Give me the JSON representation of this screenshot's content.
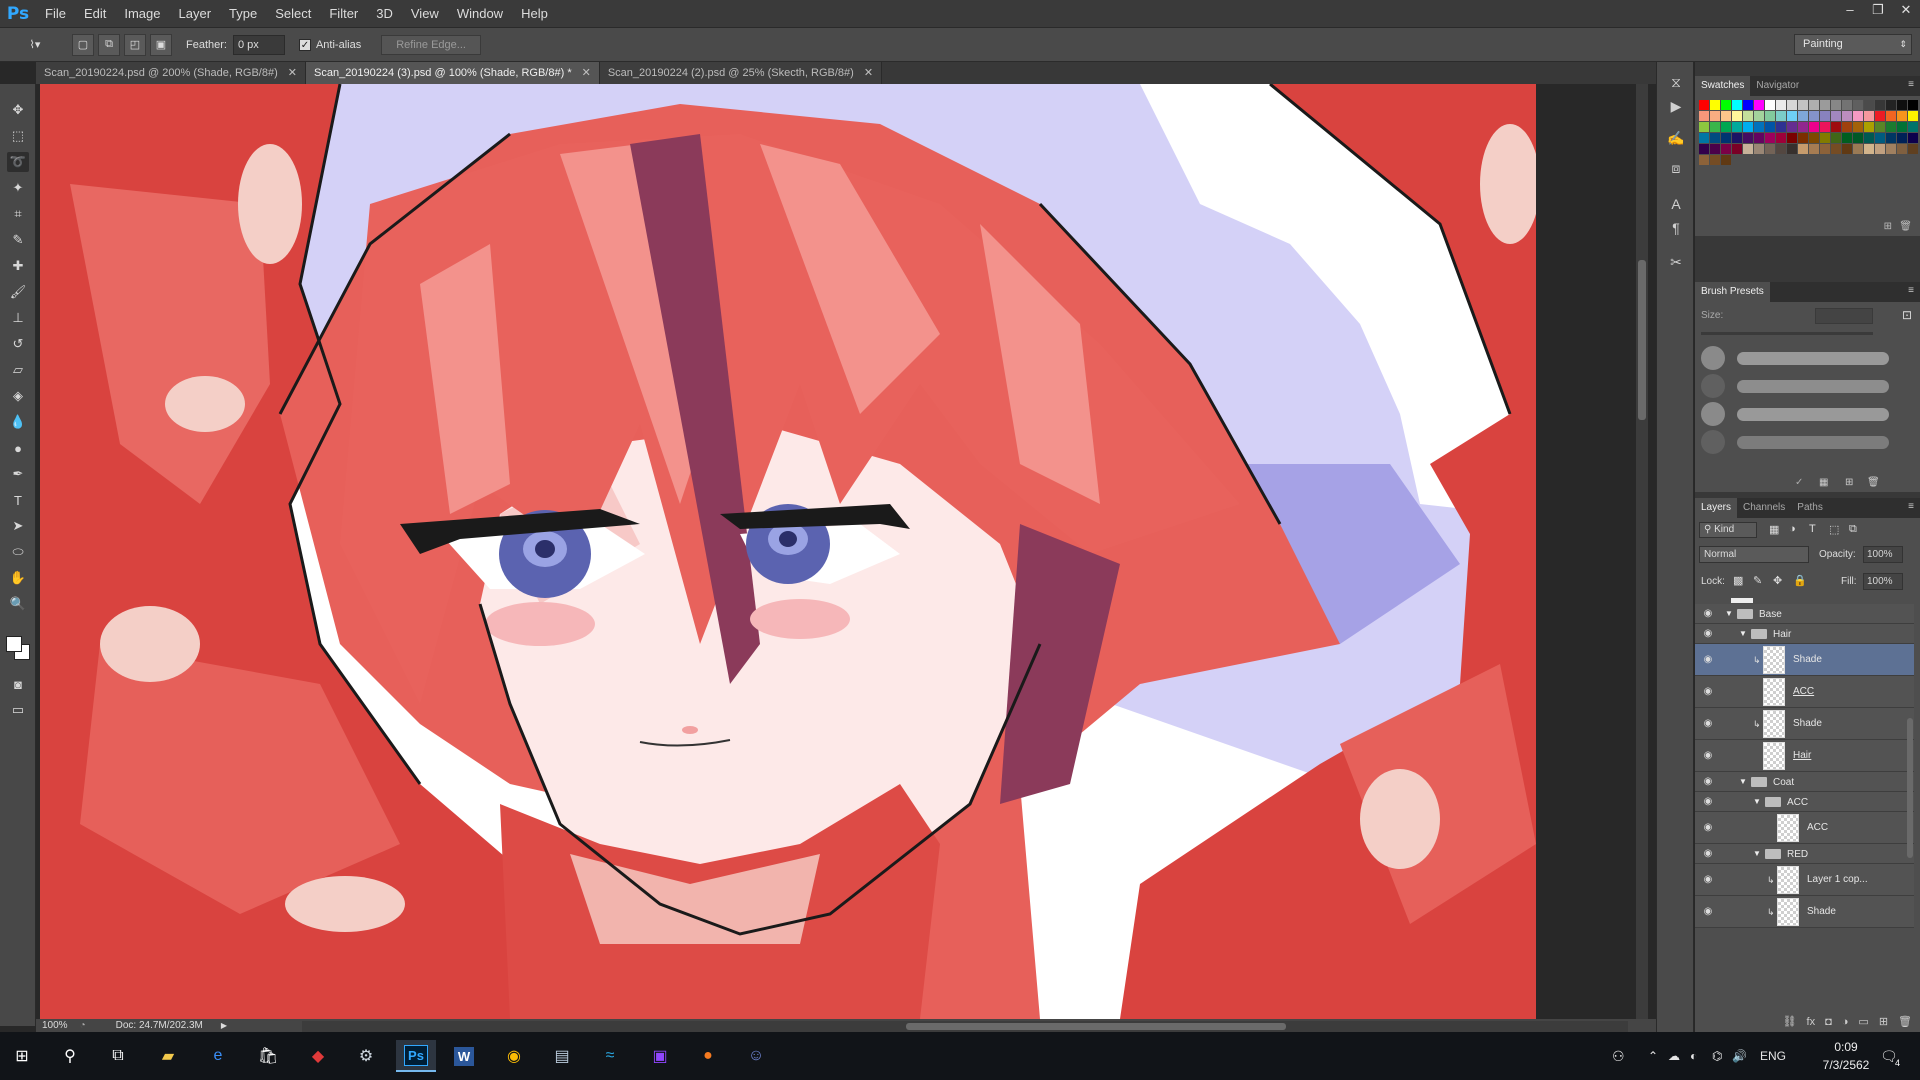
{
  "app": {
    "logo": "Ps"
  },
  "menu": [
    "File",
    "Edit",
    "Image",
    "Layer",
    "Type",
    "Select",
    "Filter",
    "3D",
    "View",
    "Window",
    "Help"
  ],
  "window_controls": [
    "–",
    "❐",
    "✕"
  ],
  "options": {
    "feather_label": "Feather:",
    "feather_value": "0 px",
    "antialias_label": "Anti-alias",
    "antialias_checked": true,
    "refine_edge": "Refine Edge...",
    "workspace": "Painting"
  },
  "doc_tabs": [
    {
      "label": "Scan_20190224.psd @ 200% (Shade, RGB/8#)",
      "active": false
    },
    {
      "label": "Scan_20190224 (3).psd @ 100% (Shade, RGB/8#) *",
      "active": true
    },
    {
      "label": "Scan_20190224 (2).psd @ 25% (Skecth, RGB/8#)",
      "active": false
    }
  ],
  "status": {
    "zoom": "100%",
    "doc": "Doc: 24.7M/202.3M"
  },
  "colors": {
    "panel_bg": "#383838",
    "selected_layer": "#5d7194",
    "hair": "#e7605a",
    "background_lilac": "#c9c6f4",
    "eye_blue": "#5b63b0"
  },
  "panels": {
    "swatches_tabs": [
      "Swatches",
      "Navigator"
    ],
    "brush_tab": "Brush Presets",
    "brush_size_label": "Size:",
    "layers_tabs": [
      "Layers",
      "Channels",
      "Paths"
    ],
    "kind_label": "Kind",
    "blend_mode": "Normal",
    "opacity_label": "Opacity:",
    "opacity_value": "100%",
    "lock_label": "Lock:",
    "fill_label": "Fill:",
    "fill_value": "100%"
  },
  "layers": [
    {
      "name": "Base",
      "type": "group",
      "indent": 0
    },
    {
      "name": "Hair",
      "type": "group",
      "indent": 1
    },
    {
      "name": "Shade",
      "type": "layer",
      "indent": 2,
      "selected": true,
      "clipped": true
    },
    {
      "name": "ACC",
      "type": "layer",
      "indent": 2,
      "underlined": true
    },
    {
      "name": "Shade",
      "type": "layer",
      "indent": 2,
      "clipped": true
    },
    {
      "name": "Hair",
      "type": "layer",
      "indent": 2,
      "underlined": true
    },
    {
      "name": "Coat",
      "type": "group",
      "indent": 1
    },
    {
      "name": "ACC",
      "type": "group",
      "indent": 2
    },
    {
      "name": "ACC",
      "type": "layer",
      "indent": 3
    },
    {
      "name": "RED",
      "type": "group",
      "indent": 2
    },
    {
      "name": "Layer 1 cop...",
      "type": "layer",
      "indent": 3,
      "clipped": true
    },
    {
      "name": "Shade",
      "type": "layer",
      "indent": 3,
      "clipped": true
    }
  ],
  "taskbar": {
    "apps": [
      "start-icon",
      "search-icon",
      "task-view-icon",
      "file-explorer-icon",
      "edge-icon",
      "store-icon",
      "app-red-icon",
      "steam-icon",
      "photoshop-icon",
      "word-icon",
      "chrome-icon",
      "app-monitor-icon",
      "app-wave-icon",
      "twitch-icon",
      "app-orange-icon",
      "discord-icon"
    ],
    "ps_label": "Ps",
    "word_label": "W",
    "lang": "ENG",
    "time": "0:09",
    "date": "7/3/2562",
    "notifications": "4"
  }
}
